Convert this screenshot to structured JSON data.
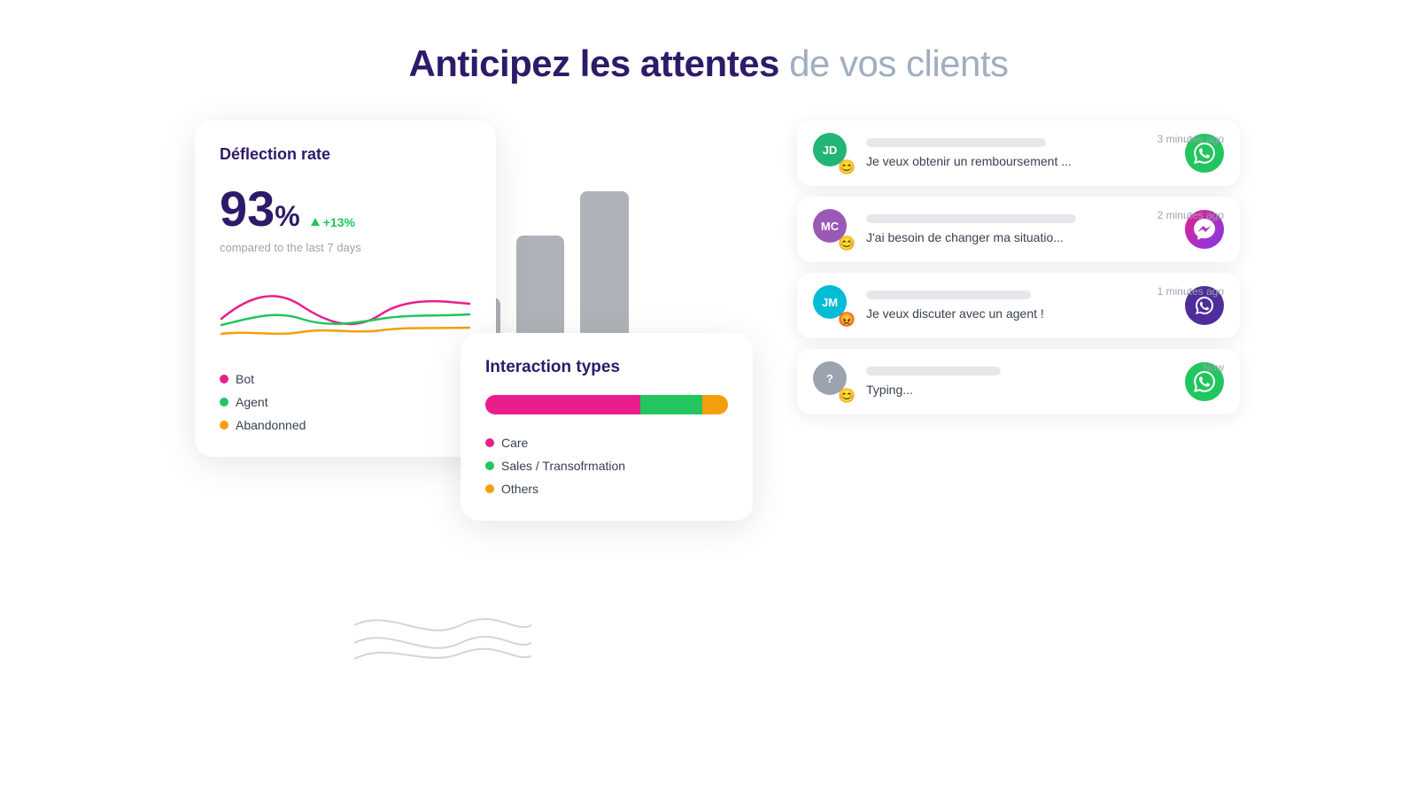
{
  "header": {
    "title_bold": "Anticipez les attentes",
    "title_light": "de vos clients"
  },
  "deflection_card": {
    "title": "Déflection rate",
    "rate": "93",
    "rate_symbol": "%",
    "badge": "+13%",
    "compare": "compared to the last 7 days",
    "legend": [
      {
        "label": "Bot",
        "color": "#e91e8c"
      },
      {
        "label": "Agent",
        "color": "#22c55e"
      },
      {
        "label": "Abandonned",
        "color": "#f59e0b"
      }
    ]
  },
  "interaction_card": {
    "title": "Interaction types",
    "legend": [
      {
        "label": "Care",
        "color": "#e91e8c"
      },
      {
        "label": "Sales / Transofrmation",
        "color": "#22c55e"
      },
      {
        "label": "Others",
        "color": "#f59e0b"
      }
    ]
  },
  "chat_messages": [
    {
      "avatar_initials": "JD",
      "avatar_color": "#22b573",
      "emoji": "😊",
      "text": "Je veux obtenir un remboursement ...",
      "time": "3 minutes ago",
      "channel": "whatsapp"
    },
    {
      "avatar_initials": "MC",
      "avatar_color": "#9b59b6",
      "emoji": "😊",
      "text": "J'ai besoin de changer ma situatio...",
      "time": "2 minutes ago",
      "channel": "messenger"
    },
    {
      "avatar_initials": "JM",
      "avatar_color": "#00bcd4",
      "emoji": "😡",
      "text": "Je veux discuter avec un agent !",
      "time": "1 minutes ago",
      "channel": "chat"
    },
    {
      "avatar_initials": "?",
      "avatar_color": "#9ca3af",
      "emoji": "😊",
      "text": "Typing...",
      "time": "Now",
      "channel": "whatsapp"
    }
  ]
}
